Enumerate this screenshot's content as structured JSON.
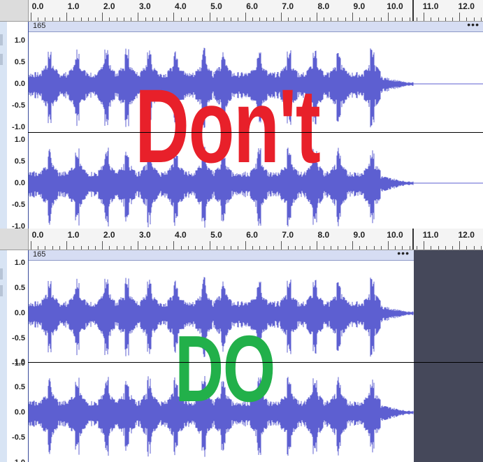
{
  "ruler_ticks": [
    "0.0",
    "1.0",
    "2.0",
    "3.0",
    "4.0",
    "5.0",
    "6.0",
    "7.0",
    "8.0",
    "9.0",
    "10.0",
    "11.0",
    "12.0"
  ],
  "top_panel": {
    "clip_name": "165",
    "clip_menu": "•••",
    "channel_scale": [
      "1.0",
      "0.5",
      "0.0",
      "-0.5",
      "-1.0"
    ],
    "overlay_text": "Don't",
    "overlay_color": "#e8202a"
  },
  "bottom_panel": {
    "clip_name": "165",
    "clip_menu": "•••",
    "channel_scale": [
      "1.0",
      "0.5",
      "0.0",
      "-0.5",
      "-1.0"
    ],
    "overlay_text": "DO",
    "overlay_color": "#22b04a"
  },
  "colors": {
    "waveform": "#5d5fd1",
    "empty_track": "#45485a",
    "clip_header": "#d6ddf3"
  }
}
